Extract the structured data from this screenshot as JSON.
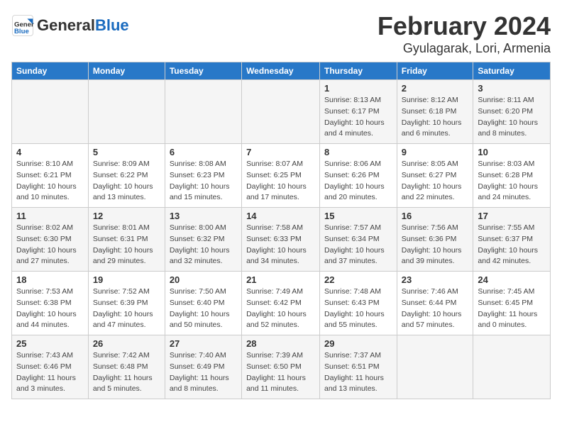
{
  "header": {
    "logo_line1": "General",
    "logo_line2": "Blue",
    "title": "February 2024",
    "subtitle": "Gyulagarak, Lori, Armenia"
  },
  "days_of_week": [
    "Sunday",
    "Monday",
    "Tuesday",
    "Wednesday",
    "Thursday",
    "Friday",
    "Saturday"
  ],
  "weeks": [
    [
      {
        "day": "",
        "info": ""
      },
      {
        "day": "",
        "info": ""
      },
      {
        "day": "",
        "info": ""
      },
      {
        "day": "",
        "info": ""
      },
      {
        "day": "1",
        "info": "Sunrise: 8:13 AM\nSunset: 6:17 PM\nDaylight: 10 hours\nand 4 minutes."
      },
      {
        "day": "2",
        "info": "Sunrise: 8:12 AM\nSunset: 6:18 PM\nDaylight: 10 hours\nand 6 minutes."
      },
      {
        "day": "3",
        "info": "Sunrise: 8:11 AM\nSunset: 6:20 PM\nDaylight: 10 hours\nand 8 minutes."
      }
    ],
    [
      {
        "day": "4",
        "info": "Sunrise: 8:10 AM\nSunset: 6:21 PM\nDaylight: 10 hours\nand 10 minutes."
      },
      {
        "day": "5",
        "info": "Sunrise: 8:09 AM\nSunset: 6:22 PM\nDaylight: 10 hours\nand 13 minutes."
      },
      {
        "day": "6",
        "info": "Sunrise: 8:08 AM\nSunset: 6:23 PM\nDaylight: 10 hours\nand 15 minutes."
      },
      {
        "day": "7",
        "info": "Sunrise: 8:07 AM\nSunset: 6:25 PM\nDaylight: 10 hours\nand 17 minutes."
      },
      {
        "day": "8",
        "info": "Sunrise: 8:06 AM\nSunset: 6:26 PM\nDaylight: 10 hours\nand 20 minutes."
      },
      {
        "day": "9",
        "info": "Sunrise: 8:05 AM\nSunset: 6:27 PM\nDaylight: 10 hours\nand 22 minutes."
      },
      {
        "day": "10",
        "info": "Sunrise: 8:03 AM\nSunset: 6:28 PM\nDaylight: 10 hours\nand 24 minutes."
      }
    ],
    [
      {
        "day": "11",
        "info": "Sunrise: 8:02 AM\nSunset: 6:30 PM\nDaylight: 10 hours\nand 27 minutes."
      },
      {
        "day": "12",
        "info": "Sunrise: 8:01 AM\nSunset: 6:31 PM\nDaylight: 10 hours\nand 29 minutes."
      },
      {
        "day": "13",
        "info": "Sunrise: 8:00 AM\nSunset: 6:32 PM\nDaylight: 10 hours\nand 32 minutes."
      },
      {
        "day": "14",
        "info": "Sunrise: 7:58 AM\nSunset: 6:33 PM\nDaylight: 10 hours\nand 34 minutes."
      },
      {
        "day": "15",
        "info": "Sunrise: 7:57 AM\nSunset: 6:34 PM\nDaylight: 10 hours\nand 37 minutes."
      },
      {
        "day": "16",
        "info": "Sunrise: 7:56 AM\nSunset: 6:36 PM\nDaylight: 10 hours\nand 39 minutes."
      },
      {
        "day": "17",
        "info": "Sunrise: 7:55 AM\nSunset: 6:37 PM\nDaylight: 10 hours\nand 42 minutes."
      }
    ],
    [
      {
        "day": "18",
        "info": "Sunrise: 7:53 AM\nSunset: 6:38 PM\nDaylight: 10 hours\nand 44 minutes."
      },
      {
        "day": "19",
        "info": "Sunrise: 7:52 AM\nSunset: 6:39 PM\nDaylight: 10 hours\nand 47 minutes."
      },
      {
        "day": "20",
        "info": "Sunrise: 7:50 AM\nSunset: 6:40 PM\nDaylight: 10 hours\nand 50 minutes."
      },
      {
        "day": "21",
        "info": "Sunrise: 7:49 AM\nSunset: 6:42 PM\nDaylight: 10 hours\nand 52 minutes."
      },
      {
        "day": "22",
        "info": "Sunrise: 7:48 AM\nSunset: 6:43 PM\nDaylight: 10 hours\nand 55 minutes."
      },
      {
        "day": "23",
        "info": "Sunrise: 7:46 AM\nSunset: 6:44 PM\nDaylight: 10 hours\nand 57 minutes."
      },
      {
        "day": "24",
        "info": "Sunrise: 7:45 AM\nSunset: 6:45 PM\nDaylight: 11 hours\nand 0 minutes."
      }
    ],
    [
      {
        "day": "25",
        "info": "Sunrise: 7:43 AM\nSunset: 6:46 PM\nDaylight: 11 hours\nand 3 minutes."
      },
      {
        "day": "26",
        "info": "Sunrise: 7:42 AM\nSunset: 6:48 PM\nDaylight: 11 hours\nand 5 minutes."
      },
      {
        "day": "27",
        "info": "Sunrise: 7:40 AM\nSunset: 6:49 PM\nDaylight: 11 hours\nand 8 minutes."
      },
      {
        "day": "28",
        "info": "Sunrise: 7:39 AM\nSunset: 6:50 PM\nDaylight: 11 hours\nand 11 minutes."
      },
      {
        "day": "29",
        "info": "Sunrise: 7:37 AM\nSunset: 6:51 PM\nDaylight: 11 hours\nand 13 minutes."
      },
      {
        "day": "",
        "info": ""
      },
      {
        "day": "",
        "info": ""
      }
    ]
  ]
}
